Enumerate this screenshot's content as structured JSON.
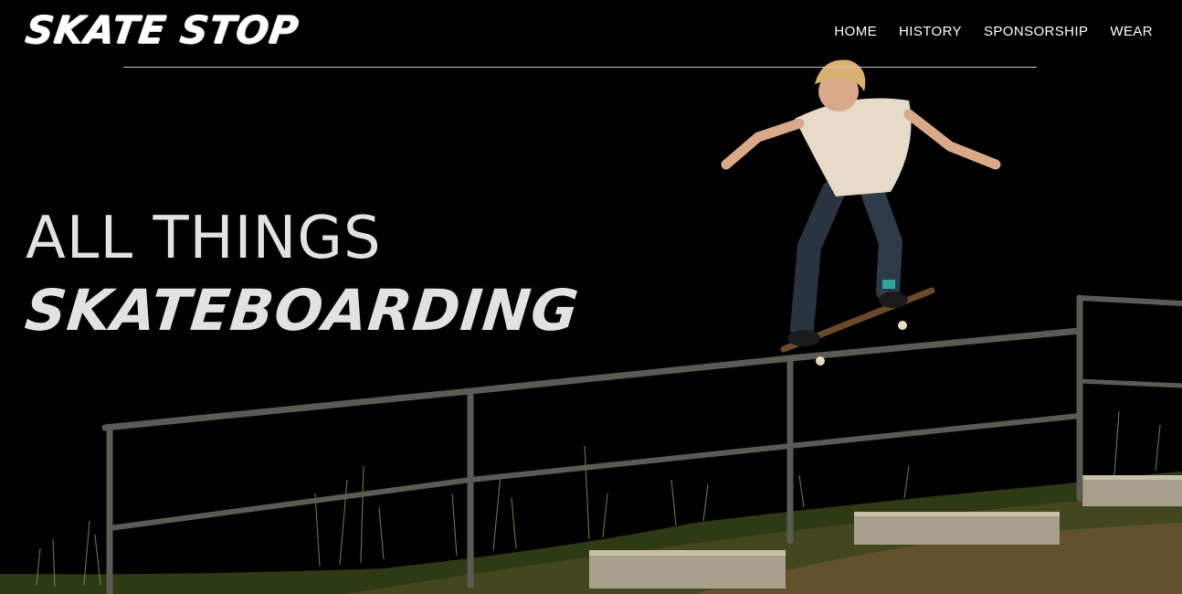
{
  "brand": {
    "logo_text": "SKATE STOP"
  },
  "nav": {
    "items": [
      {
        "label": "HOME"
      },
      {
        "label": "HISTORY"
      },
      {
        "label": "SPONSORSHIP"
      },
      {
        "label": "WEAR"
      }
    ]
  },
  "hero": {
    "line1": "ALL THINGS",
    "line2": "SKATEBOARDING",
    "image": "skater-grinding-handrail-at-night"
  }
}
